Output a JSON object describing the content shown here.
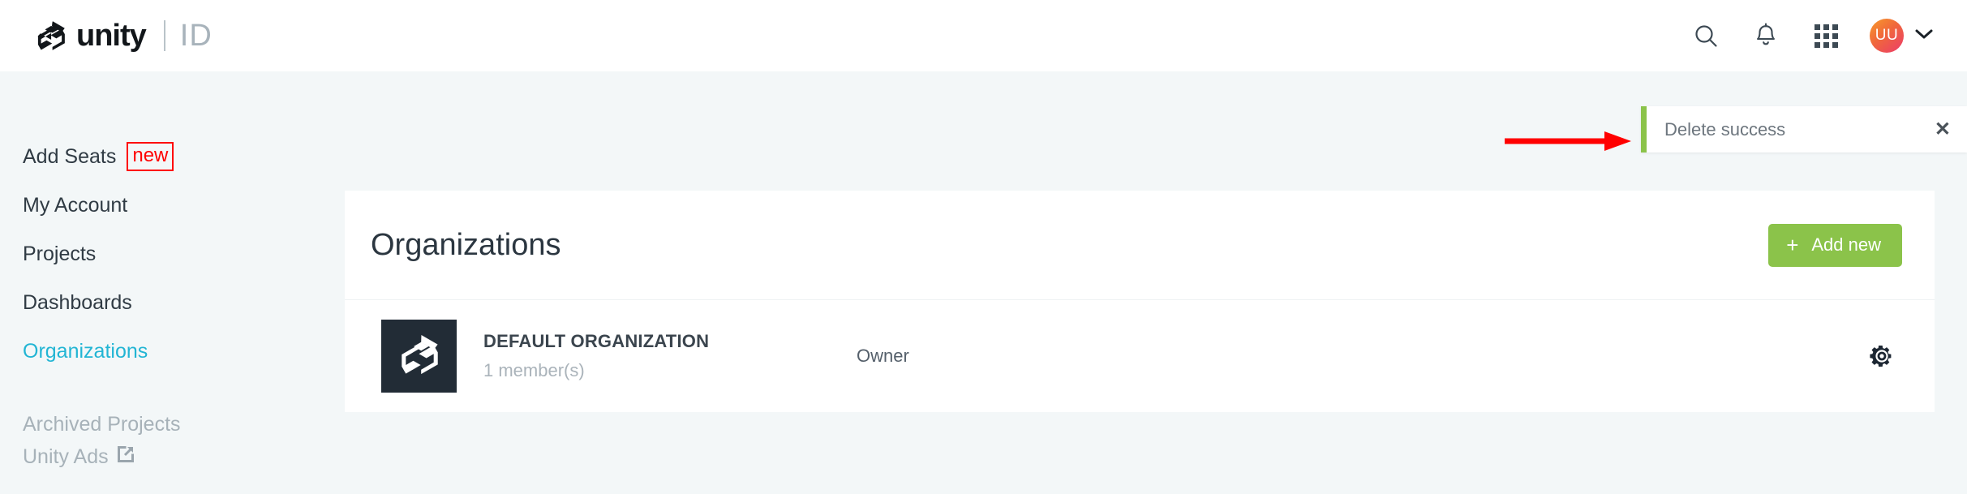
{
  "header": {
    "brand_word": "unity",
    "brand_product": "ID",
    "logo_icon": "unity-cube-logo",
    "search_icon": "search-icon",
    "notifications_icon": "bell-icon",
    "apps_icon": "grid-apps-icon",
    "avatar_initials": "UU",
    "avatar_chevron_icon": "chevron-down-icon"
  },
  "sidebar": {
    "items": [
      {
        "label": "Add Seats",
        "badge": "new",
        "active": false
      },
      {
        "label": "My Account",
        "badge": "",
        "active": false
      },
      {
        "label": "Projects",
        "badge": "",
        "active": false
      },
      {
        "label": "Dashboards",
        "badge": "",
        "active": false
      },
      {
        "label": "Organizations",
        "badge": "",
        "active": true
      }
    ],
    "secondary_items": [
      {
        "label": "Archived Projects",
        "external": false
      },
      {
        "label": "Unity Ads",
        "external": true,
        "external_icon": "external-link-icon"
      }
    ]
  },
  "main": {
    "title": "Organizations",
    "add_new_label": "Add new",
    "add_new_plus": "+",
    "organizations": [
      {
        "logo_icon": "unity-cube-logo",
        "name": "DEFAULT ORGANIZATION",
        "members": "1 member(s)",
        "role": "Owner",
        "settings_icon": "gear-icon"
      }
    ]
  },
  "toast": {
    "message": "Delete success",
    "close_label": "✕",
    "accent_color": "#8bc34a"
  },
  "annotation": {
    "type": "arrow",
    "color": "#ff0000",
    "points_to": "toast"
  },
  "colors": {
    "page_background": "#f3f7f8",
    "accent_cyan": "#22b5d4",
    "accent_green": "#8bc34a",
    "badge_red": "#ff0000",
    "org_logo_bg": "#222c36"
  }
}
